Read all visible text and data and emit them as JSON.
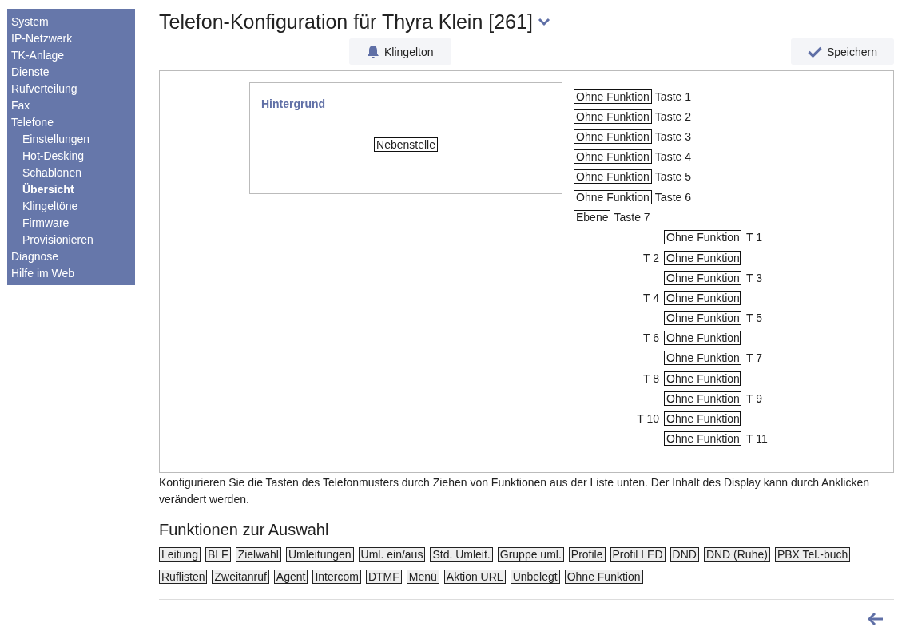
{
  "sidebar": {
    "items": [
      {
        "label": "System",
        "selected": false
      },
      {
        "label": "IP-Netzwerk",
        "selected": false
      },
      {
        "label": "TK-Anlage",
        "selected": false
      },
      {
        "label": "Dienste",
        "selected": false
      },
      {
        "label": "Rufverteilung",
        "selected": false
      },
      {
        "label": "Fax",
        "selected": false
      },
      {
        "label": "Telefone",
        "selected": false,
        "children": [
          {
            "label": "Einstellungen",
            "selected": false
          },
          {
            "label": "Hot-Desking",
            "selected": false
          },
          {
            "label": "Schablonen",
            "selected": false
          },
          {
            "label": "Übersicht",
            "selected": true
          },
          {
            "label": "Klingeltöne",
            "selected": false
          },
          {
            "label": "Firmware",
            "selected": false
          },
          {
            "label": "Provisionieren",
            "selected": false
          }
        ]
      },
      {
        "label": "Diagnose",
        "selected": false
      },
      {
        "label": "Hilfe im Web",
        "selected": false
      }
    ]
  },
  "title": "Telefon-Konfiguration für Thyra Klein [261]",
  "toolbar": {
    "ringtone_button": "Klingelton",
    "save_button": "Speichern"
  },
  "phone": {
    "display": {
      "background_link": "Hintergrund",
      "field": "Nebenstelle"
    },
    "keys": [
      {
        "function": "Ohne Funktion",
        "label": "Taste 1"
      },
      {
        "function": "Ohne Funktion",
        "label": "Taste 2"
      },
      {
        "function": "Ohne Funktion",
        "label": "Taste 3"
      },
      {
        "function": "Ohne Funktion",
        "label": "Taste 4"
      },
      {
        "function": "Ohne Funktion",
        "label": "Taste 5"
      },
      {
        "function": "Ohne Funktion",
        "label": "Taste 6"
      },
      {
        "function": "Ebene",
        "label": "Taste 7"
      }
    ],
    "expansion_keys": [
      {
        "kind": "label_right",
        "function": "Ohne Funktion",
        "label": "T 1"
      },
      {
        "kind": "label_left",
        "function": "Ohne Funktion",
        "label": "T 2"
      },
      {
        "kind": "label_right",
        "function": "Ohne Funktion",
        "label": "T 3"
      },
      {
        "kind": "label_left",
        "function": "Ohne Funktion",
        "label": "T 4"
      },
      {
        "kind": "label_right",
        "function": "Ohne Funktion",
        "label": "T 5"
      },
      {
        "kind": "label_left",
        "function": "Ohne Funktion",
        "label": "T 6"
      },
      {
        "kind": "label_right",
        "function": "Ohne Funktion",
        "label": "T 7"
      },
      {
        "kind": "label_left",
        "function": "Ohne Funktion",
        "label": "T 8"
      },
      {
        "kind": "label_right",
        "function": "Ohne Funktion",
        "label": "T 9"
      },
      {
        "kind": "label_left",
        "function": "Ohne Funktion",
        "label": "T 10"
      },
      {
        "kind": "label_right",
        "function": "Ohne Funktion",
        "label": "T 11"
      }
    ]
  },
  "description": "Konfigurieren Sie die Tasten des Telefonmusters durch Ziehen von Funktionen aus der Liste unten. Der Inhalt des Display kann durch Anklicken verändert werden.",
  "functions": {
    "heading": "Funktionen zur Auswahl",
    "items": [
      "Leitung",
      "BLF",
      "Zielwahl",
      "Umleitungen",
      "Uml. ein/aus",
      "Std. Umleit.",
      "Gruppe uml.",
      "Profile",
      "Profil LED",
      "DND",
      "DND (Ruhe)",
      "PBX Tel.-buch",
      "Ruflisten",
      "Zweitanruf",
      "Agent",
      "Intercom",
      "DTMF",
      "Menü",
      "Aktion URL",
      "Unbelegt",
      "Ohne Funktion"
    ]
  }
}
